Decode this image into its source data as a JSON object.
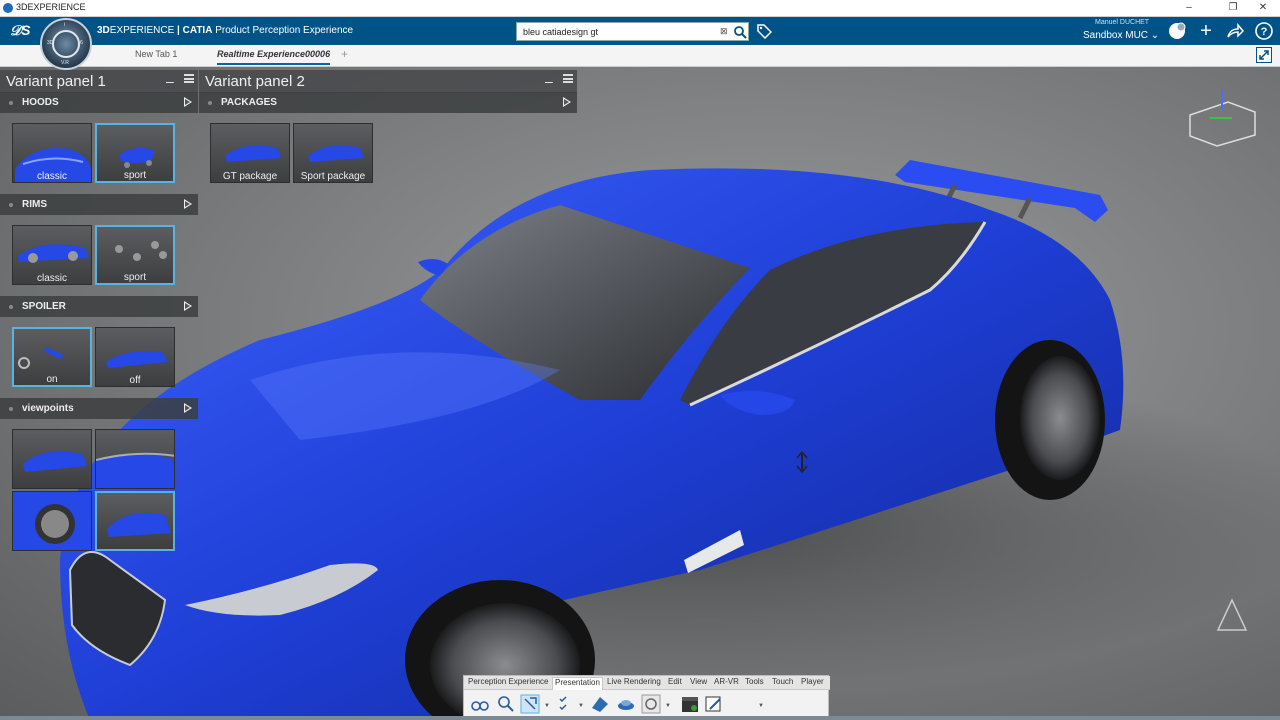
{
  "window": {
    "title": "3DEXPERIENCE",
    "buttons": [
      "–",
      "❐",
      "✕"
    ]
  },
  "topbar": {
    "brand_3d": "3D",
    "brand_experience": "EXPERIENCE",
    "brand_app": " | CATIA",
    "brand_role": " Product Perception Experience",
    "search_value": "bleu catiadesign gt",
    "user_name": "Manuel DUCHET",
    "user_space": "Sandbox MUC",
    "compass_labels": [
      "V.R",
      "3D",
      "i",
      "6"
    ]
  },
  "tabs": [
    {
      "label": "New Tab 1",
      "active": false
    },
    {
      "label": "Realtime Experience00006",
      "active": true
    }
  ],
  "panel1": {
    "title": "Variant panel 1",
    "sections": [
      {
        "name": "HOODS",
        "items": [
          {
            "label": "classic",
            "selected": false
          },
          {
            "label": "sport",
            "selected": true
          }
        ]
      },
      {
        "name": "RIMS",
        "items": [
          {
            "label": "classic",
            "selected": false
          },
          {
            "label": "sport",
            "selected": true
          }
        ]
      },
      {
        "name": "SPOILER",
        "items": [
          {
            "label": "on",
            "selected": true
          },
          {
            "label": "off",
            "selected": false
          }
        ]
      },
      {
        "name": "viewpoints",
        "items": [
          {
            "label": ""
          },
          {
            "label": ""
          },
          {
            "label": ""
          },
          {
            "label": ""
          }
        ]
      }
    ]
  },
  "panel2": {
    "title": "Variant panel 2",
    "sections": [
      {
        "name": "PACKAGES",
        "items": [
          {
            "label": "GT package",
            "selected": false
          },
          {
            "label": "Sport package",
            "selected": false
          }
        ]
      }
    ]
  },
  "action_bar": {
    "tabs": [
      {
        "label": "Perception Experience",
        "active": false
      },
      {
        "label": "Presentation",
        "active": true
      },
      {
        "label": "Live Rendering",
        "active": false
      },
      {
        "label": "Edit",
        "active": false
      },
      {
        "label": "View",
        "active": false
      },
      {
        "label": "AR-VR",
        "active": false
      },
      {
        "label": "Tools",
        "active": false
      },
      {
        "label": "Touch",
        "active": false
      },
      {
        "label": "Player",
        "active": false
      }
    ]
  },
  "colors": {
    "brand_blue": "#005386",
    "car_blue": "#1f3fd6",
    "selection": "#58b3e3"
  }
}
